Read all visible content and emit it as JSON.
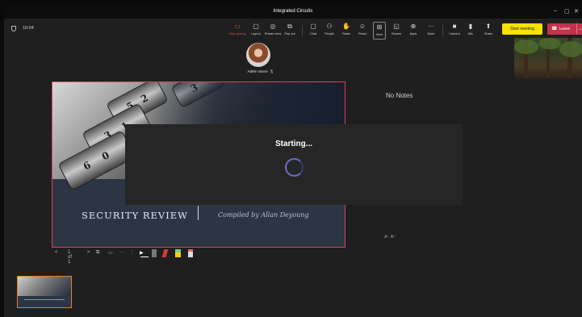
{
  "window": {
    "title": "Integrated Circuits",
    "controls": {
      "minimize": "–",
      "maximize": "▢",
      "close": "✕"
    }
  },
  "toolbar": {
    "timer": "10:04",
    "buttons": [
      {
        "key": "stop-sharing",
        "label": "Stop sharing",
        "icon": "▭"
      },
      {
        "key": "layout",
        "label": "Layout",
        "icon": "▢"
      },
      {
        "key": "private-view",
        "label": "Private view",
        "icon": "◎"
      },
      {
        "key": "pop-out",
        "label": "Pop out",
        "icon": "⧉"
      },
      {
        "key": "chat",
        "label": "Chat",
        "icon": "▢"
      },
      {
        "key": "people",
        "label": "People",
        "icon": "⚇"
      },
      {
        "key": "raise",
        "label": "Raise",
        "icon": "✋"
      },
      {
        "key": "react",
        "label": "React",
        "icon": "☺"
      },
      {
        "key": "view",
        "label": "View",
        "icon": "⊞"
      },
      {
        "key": "rooms",
        "label": "Rooms",
        "icon": "◱"
      },
      {
        "key": "apps",
        "label": "Apps",
        "icon": "⊕"
      },
      {
        "key": "more",
        "label": "More",
        "icon": "···"
      },
      {
        "key": "camera",
        "label": "Camera",
        "icon": "■"
      },
      {
        "key": "mic",
        "label": "Mic",
        "icon": "▮"
      },
      {
        "key": "share",
        "label": "Share",
        "icon": "⬆"
      }
    ],
    "start_meeting": "Start meeting",
    "leave": "Leave"
  },
  "participant": {
    "name": "Adele Vance"
  },
  "slide": {
    "title": "SECURITY REVIEW",
    "subtitle": "Compiled by Allan Deyoung"
  },
  "overlay": {
    "text": "Starting..."
  },
  "notes": {
    "empty_text": "No Notes",
    "font_controls": "A⁻  A⁺"
  },
  "slide_controls": {
    "prev": "<",
    "page": "1 of 1",
    "next": ">"
  },
  "colors": {
    "accent_red": "#c4314b",
    "start_meeting_yellow": "#f7e100",
    "slide_border": "#e0405a",
    "thumb_border": "#e0822f"
  }
}
